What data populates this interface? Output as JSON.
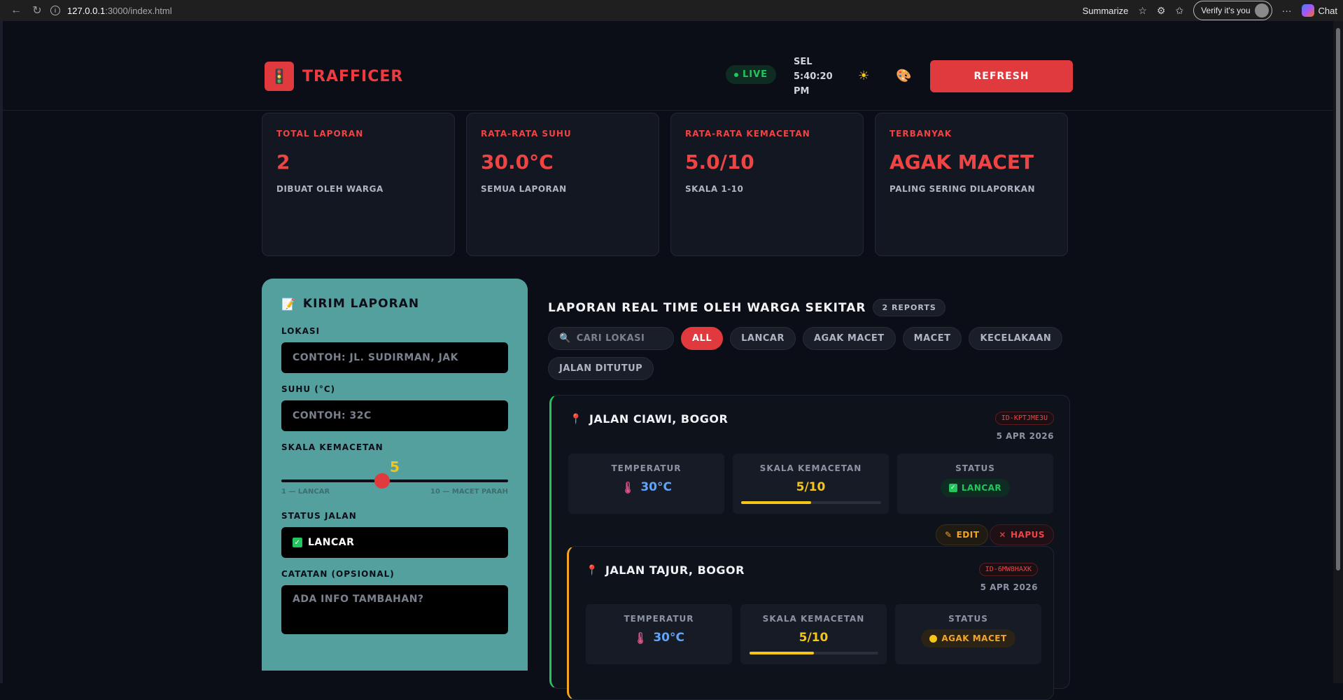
{
  "browser": {
    "url_host": "127.0.0.1",
    "url_path": ":3000/index.html",
    "summarize_label": "Summarize",
    "verify_label": "Verify it's you",
    "chat_label": "Chat"
  },
  "header": {
    "brand": "TRAFFICER",
    "live": "LIVE",
    "clock": "SEL 5:40:20 PM",
    "refresh": "REFRESH"
  },
  "stats": [
    {
      "label": "TOTAL LAPORAN",
      "value": "2",
      "sub": "DIBUAT OLEH WARGA"
    },
    {
      "label": "RATA-RATA SUHU",
      "value": "30.0°C",
      "sub": "SEMUA LAPORAN"
    },
    {
      "label": "RATA-RATA KEMACETAN",
      "value": "5.0/10",
      "sub": "SKALA 1-10"
    },
    {
      "label": "TERBANYAK",
      "value": "AGAK MACET",
      "sub": "PALING SERING DILAPORKAN"
    }
  ],
  "form": {
    "title": "KIRIM LAPORAN",
    "lokasi_label": "LOKASI",
    "lokasi_placeholder": "CONTOH: JL. SUDIRMAN, JAK",
    "suhu_label": "SUHU (°C)",
    "suhu_placeholder": "CONTOH: 32C",
    "skala_label": "SKALA KEMACETAN",
    "skala_value": "5",
    "skala_fraction": 0.444,
    "scale_min": "1 — LANCAR",
    "scale_max": "10 — MACET PARAH",
    "status_label": "STATUS JALAN",
    "status_value": "LANCAR",
    "catatan_label": "CATATAN (OPSIONAL)",
    "catatan_placeholder": "ADA INFO TAMBAHAN?"
  },
  "list": {
    "title": "LAPORAN REAL TIME OLEH WARGA SEKITAR",
    "count": "2 REPORTS",
    "search_placeholder": "CARI LOKASI",
    "filters": [
      "ALL",
      "LANCAR",
      "AGAK MACET",
      "MACET",
      "KECELAKAAN",
      "JALAN DITUTUP"
    ],
    "active_filter": "ALL"
  },
  "labels": {
    "temperatur": "TEMPERATUR",
    "skala": "SKALA KEMACETAN",
    "status": "STATUS",
    "edit": "EDIT",
    "hapus": "HAPUS"
  },
  "reports": [
    {
      "title": "JALAN CIAWI, BOGOR",
      "id": "ID-KPTJME3U",
      "date": "5 APR 2026",
      "temp": "30°C",
      "skala": "5/10",
      "skala_fraction": 0.5,
      "status": "LANCAR",
      "accent": "#22c55e"
    },
    {
      "title": "JALAN TAJUR, BOGOR",
      "id": "ID-6MW8HAXK",
      "date": "5 APR 2026",
      "temp": "30°C",
      "skala": "5/10",
      "skala_fraction": 0.5,
      "status": "AGAK MACET",
      "accent": "#f5a524"
    }
  ],
  "colors": {
    "brand": "#e03a3e",
    "panel": "#53a09f",
    "background": "#0b0e16"
  }
}
